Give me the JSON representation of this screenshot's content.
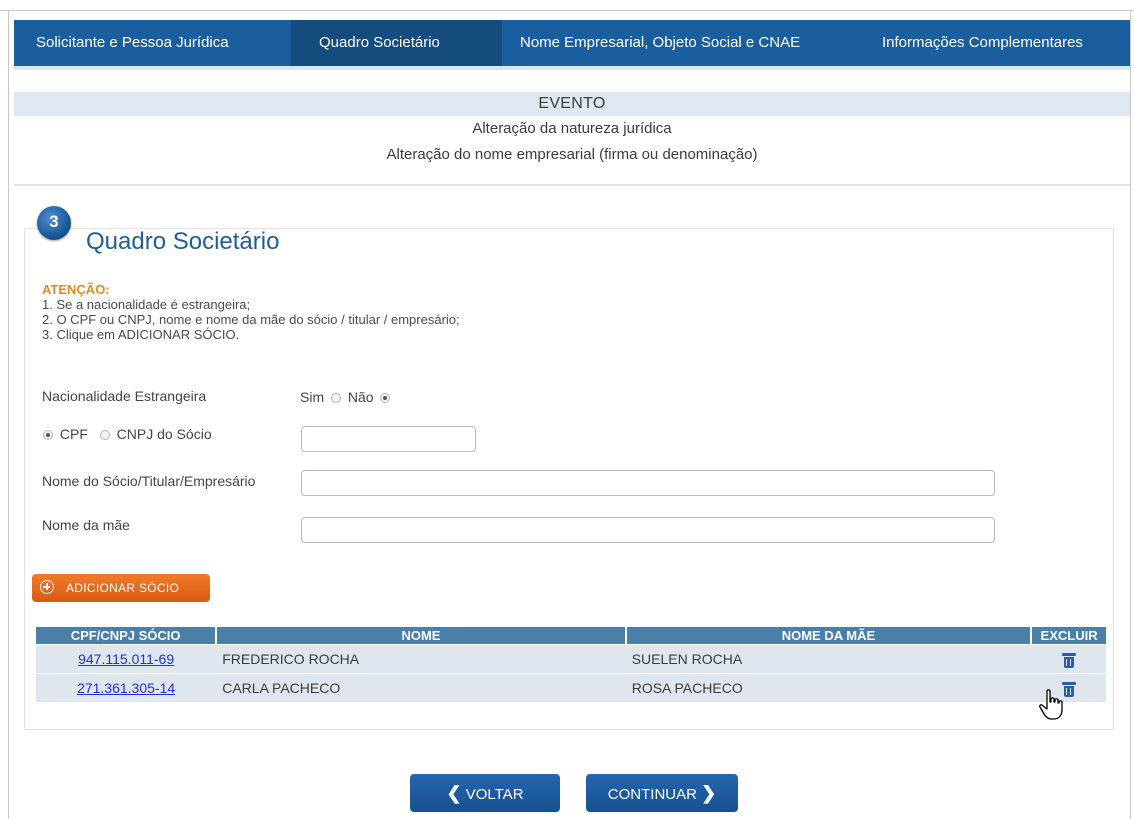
{
  "tabs": [
    {
      "label": "Solicitante e Pessoa Jurídica",
      "active": false
    },
    {
      "label": "Quadro Societário",
      "active": true
    },
    {
      "label": "Nome Empresarial, Objeto Social e CNAE",
      "active": false
    },
    {
      "label": "Informações Complementares",
      "active": false
    }
  ],
  "evento": {
    "title": "EVENTO",
    "items": [
      "Alteração da natureza jurídica",
      "Alteração do nome empresarial (firma ou denominação)"
    ]
  },
  "section": {
    "step": "3",
    "title": "Quadro Societário"
  },
  "attention": {
    "title": "ATENÇÃO:",
    "lines": [
      "1. Se a nacionalidade é estrangeira;",
      "2. O CPF ou CNPJ, nome e nome da mãe do sócio / titular / empresário;",
      "3. Clique em ADICIONAR SÓCIO."
    ]
  },
  "form": {
    "nacionalidade_label": "Nacionalidade Estrangeira",
    "sim_label": "Sim",
    "nao_label": "Não",
    "nacionalidade_selected": "Não",
    "cpf_label": "CPF",
    "cnpj_label": "CNPJ do Sócio",
    "doc_type_selected": "CPF",
    "nome_socio_label": "Nome do Sócio/Titular/Empresário",
    "nome_mae_label": "Nome da mãe",
    "cpf_value": "",
    "nome_socio_value": "",
    "nome_mae_value": ""
  },
  "add_button": {
    "label": "ADICIONAR SÓCIO"
  },
  "table": {
    "headers": [
      "CPF/CNPJ SÓCIO",
      "NOME",
      "NOME DA MÃE",
      "EXCLUIR"
    ],
    "rows": [
      {
        "cpf": "947.115.011-69",
        "nome": "FREDERICO ROCHA",
        "mae": "SUELEN ROCHA"
      },
      {
        "cpf": "271.361.305-14",
        "nome": "CARLA PACHECO",
        "mae": "ROSA PACHECO"
      }
    ]
  },
  "nav": {
    "back_label": "VOLTAR",
    "continue_label": "CONTINUAR"
  },
  "colors": {
    "tab_bg": "#1b5e9e",
    "accent_orange": "#e8701f",
    "table_header": "#4a7fa8"
  }
}
